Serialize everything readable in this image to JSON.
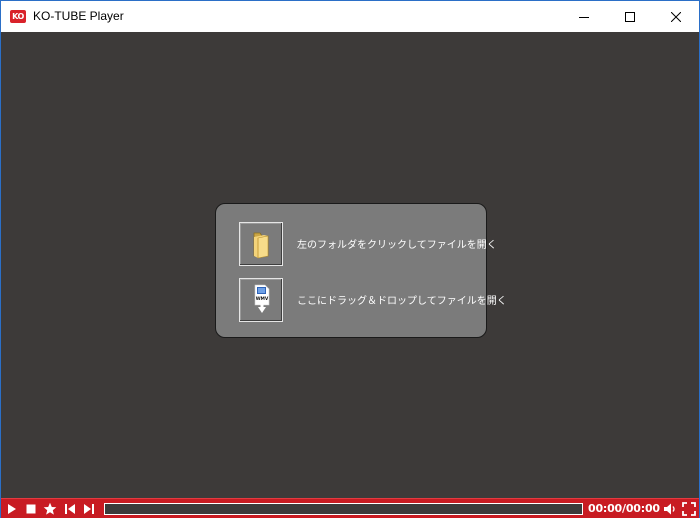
{
  "window": {
    "title": "KO-TUBE Player",
    "logo_text": "KO"
  },
  "open_panel": {
    "folder_label": "左のフォルダをクリックしてファイルを開く",
    "drop_label": "ここにドラッグ＆ドロップしてファイルを開く",
    "drop_icon_text": "WMV"
  },
  "controls": {
    "time": "00:00/00:00",
    "progress": 0
  },
  "icons": [
    "play-icon",
    "stop-icon",
    "star-icon",
    "previous-icon",
    "next-icon",
    "volume-icon",
    "fullscreen-icon",
    "folder-icon",
    "file-drop-icon"
  ],
  "colors": {
    "accent": "#c81b22",
    "background": "#3d3a39",
    "panel": "#7b7b7b"
  }
}
